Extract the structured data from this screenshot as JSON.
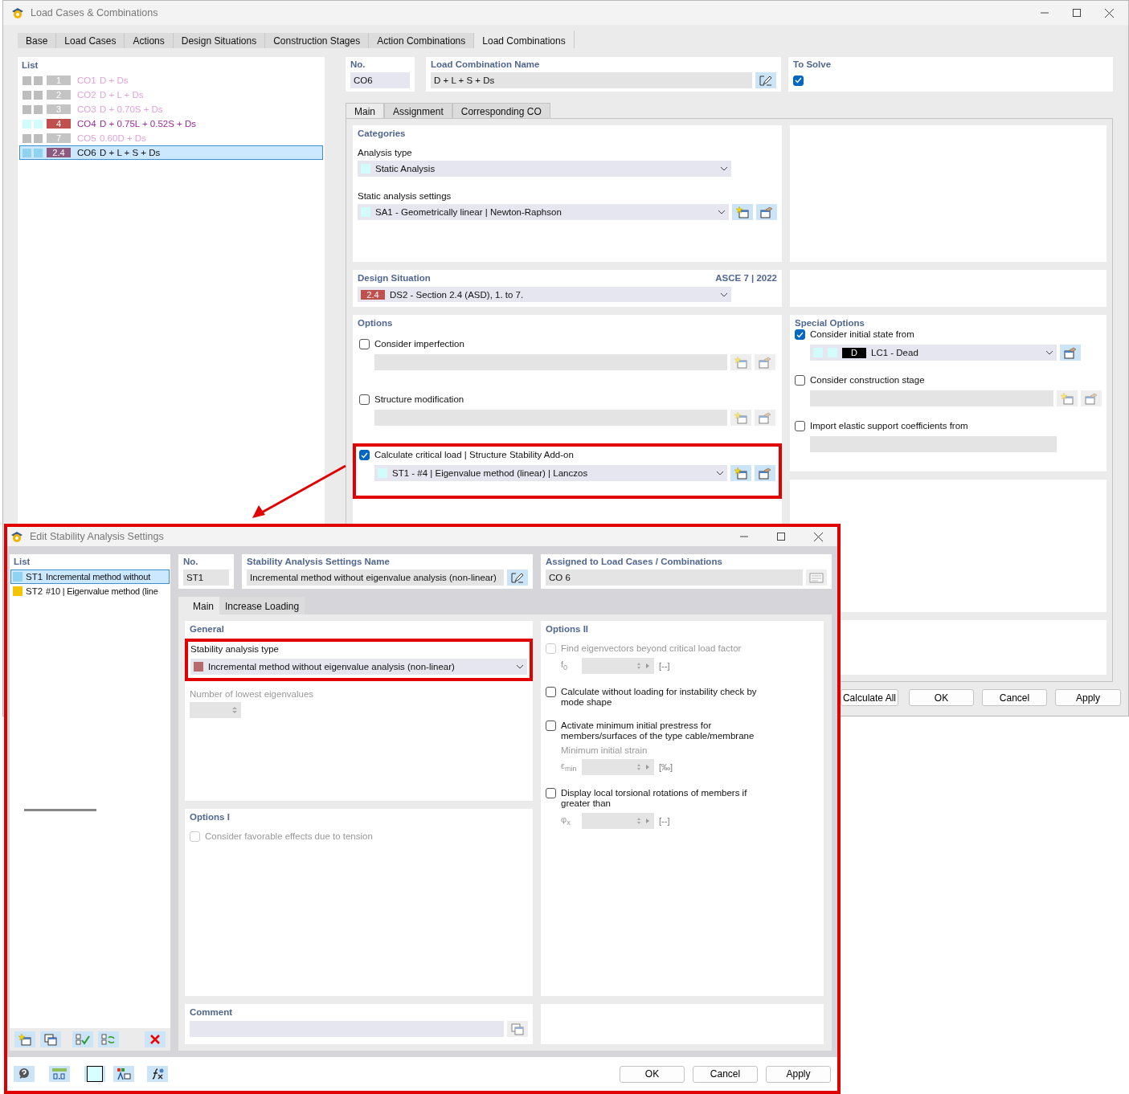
{
  "main_window": {
    "title": "Load Cases & Combinations",
    "tabs": [
      {
        "label": "Base",
        "selected": false
      },
      {
        "label": "Load Cases",
        "selected": false
      },
      {
        "label": "Actions",
        "selected": false
      },
      {
        "label": "Design Situations",
        "selected": false
      },
      {
        "label": "Construction Stages",
        "selected": false
      },
      {
        "label": "Action Combinations",
        "selected": false
      },
      {
        "label": "Load Combinations",
        "selected": true
      }
    ],
    "list": {
      "title": "List",
      "rows": [
        {
          "badge": "1",
          "color": "#c4c4c4",
          "id": "CO1",
          "name": "D + Ds",
          "active": false,
          "selected": false
        },
        {
          "badge": "2",
          "color": "#c4c4c4",
          "id": "CO2",
          "name": "D + L + Ds",
          "active": false,
          "selected": false
        },
        {
          "badge": "3",
          "color": "#c4c4c4",
          "id": "CO3",
          "name": "D + 0.70S + Ds",
          "active": false,
          "selected": false
        },
        {
          "badge": "4",
          "color": "#c0504d",
          "id": "CO4",
          "name": "D + 0.75L + 0.52S + Ds",
          "active": true,
          "selected": false
        },
        {
          "badge": "7",
          "color": "#c4c4c4",
          "id": "CO5",
          "name": "0.60D + Ds",
          "active": false,
          "selected": false
        },
        {
          "badge": "2.4",
          "color": "#8c5a7e",
          "id": "CO6",
          "name": "D + L + S + Ds",
          "active": true,
          "selected": true
        }
      ]
    },
    "number": {
      "label": "No.",
      "value": "CO6"
    },
    "name": {
      "label": "Load Combination Name",
      "value": "D + L + S + Ds"
    },
    "to_solve": {
      "label": "To Solve",
      "checked": true
    },
    "subtabs": [
      {
        "label": "Main",
        "selected": true
      },
      {
        "label": "Assignment",
        "selected": false
      },
      {
        "label": "Corresponding CO",
        "selected": false
      }
    ],
    "categories": {
      "title": "Categories",
      "analysis_type_label": "Analysis type",
      "analysis_type": "Static Analysis",
      "settings_label": "Static analysis settings",
      "settings": "SA1 - Geometrically linear | Newton-Raphson"
    },
    "design_situation": {
      "title": "Design Situation",
      "standard": "ASCE 7 | 2022",
      "badge": "2.4",
      "color": "#c0504d",
      "value": "DS2 - Section 2.4 (ASD), 1. to 7."
    },
    "options": {
      "title": "Options",
      "items": [
        {
          "label": "Consider imperfection",
          "checked": false,
          "highlighted": false
        },
        {
          "label": "Structure modification",
          "checked": false,
          "highlighted": false
        },
        {
          "label": "Calculate critical load | Structure Stability Add-on",
          "checked": true,
          "highlighted": true,
          "value": "ST1 - #4 | Eigenvalue method (linear) | Lanczos"
        }
      ]
    },
    "special_options": {
      "title": "Special Options",
      "items": [
        {
          "label": "Consider initial state from",
          "checked": true,
          "kind": "one-button",
          "badge": "D",
          "value": "LC1 - Dead"
        },
        {
          "label": "Consider construction stage",
          "checked": false,
          "kind": "two-buttons"
        },
        {
          "label": "Import elastic support coefficients from",
          "checked": false,
          "kind": "no-buttons"
        }
      ]
    },
    "buttons": [
      "Calculate All",
      "OK",
      "Cancel",
      "Apply"
    ]
  },
  "stability_dialog": {
    "title": "Edit Stability Analysis Settings",
    "list": {
      "title": "List",
      "rows": [
        {
          "id": "ST1",
          "name": "Incremental method without",
          "color": "#8fd3f0",
          "selected": true
        },
        {
          "id": "ST2",
          "name": "#10 | Eigenvalue method (line",
          "color": "#f5c400",
          "selected": false
        }
      ]
    },
    "number": {
      "label": "No.",
      "value": "ST1"
    },
    "name": {
      "label": "Stability Analysis Settings Name",
      "value": "Incremental method without eigenvalue analysis (non-linear)"
    },
    "assigned": {
      "label": "Assigned to Load Cases / Combinations",
      "value": "CO 6"
    },
    "tabs": [
      {
        "label": "Main",
        "selected": true
      },
      {
        "label": "Increase Loading",
        "selected": false
      }
    ],
    "general": {
      "title": "General",
      "type_label": "Stability analysis type",
      "type_value": "Incremental method without eigenvalue analysis (non-linear)",
      "color": "#b86a6a",
      "eigen_label": "Number of lowest eigenvalues"
    },
    "options_1": {
      "title": "Options I",
      "items": [
        {
          "label": "Consider favorable effects due to tension",
          "checked": false,
          "disabled": true
        }
      ]
    },
    "options_2": {
      "title": "Options II",
      "items": [
        {
          "kind": "spin",
          "label": "Find eigenvectors beyond critical load factor",
          "checked": false,
          "disabled": true,
          "symbol": "f$_{0}$",
          "unit": "[--]"
        },
        {
          "kind": "plain",
          "label": "Calculate without loading for instability check by mode shape",
          "checked": false,
          "disabled": false
        },
        {
          "kind": "hint-spin",
          "label": "Activate minimum initial prestress for members/surfaces of the type cable/membrane",
          "checked": false,
          "disabled": false,
          "hint": "Minimum initial strain",
          "symbol": "ε$_{min}$",
          "unit": "[‰]"
        },
        {
          "kind": "spin",
          "label": "Display local torsional rotations of members if greater than",
          "checked": false,
          "disabled": false,
          "symbol": "φ$_{x}$",
          "unit": "[--]"
        }
      ]
    },
    "comment": {
      "title": "Comment"
    },
    "buttons": [
      "OK",
      "Cancel",
      "Apply"
    ]
  }
}
